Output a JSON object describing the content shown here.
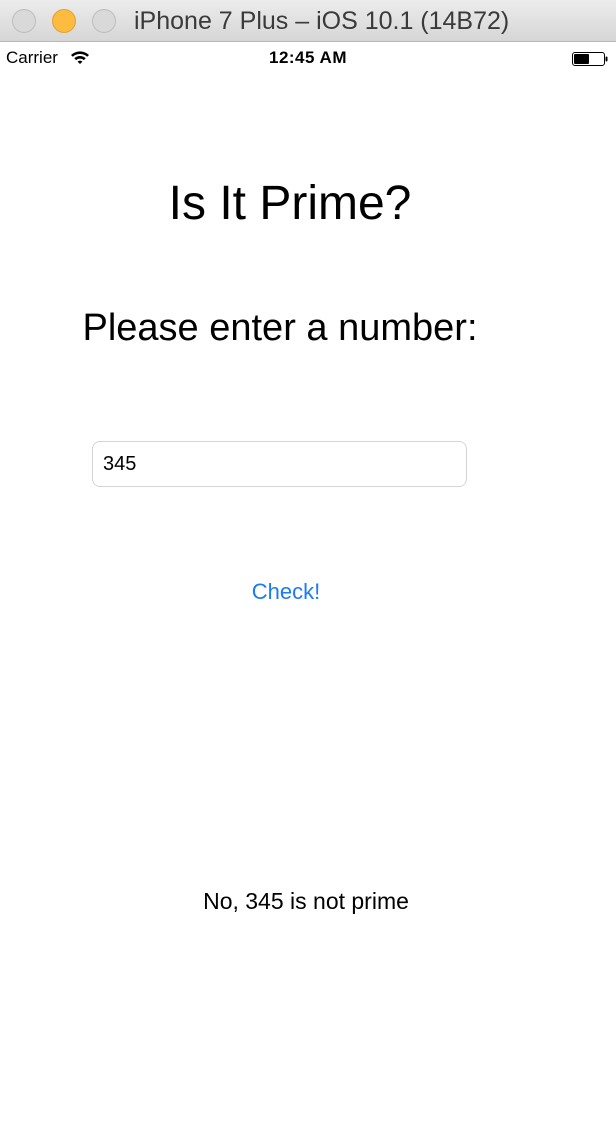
{
  "window": {
    "title": "iPhone 7 Plus – iOS 10.1 (14B72)",
    "accent_minimize": "#fdbc40"
  },
  "status_bar": {
    "carrier": "Carrier",
    "time": "12:45 AM",
    "wifi_icon": "wifi-icon",
    "battery_icon": "battery-icon"
  },
  "app": {
    "title": "Is It Prime?",
    "prompt": "Please enter a number:",
    "input_value": "345",
    "check_label": "Check!",
    "result": "No, 345 is not prime",
    "button_color": "#1b7cf0"
  }
}
